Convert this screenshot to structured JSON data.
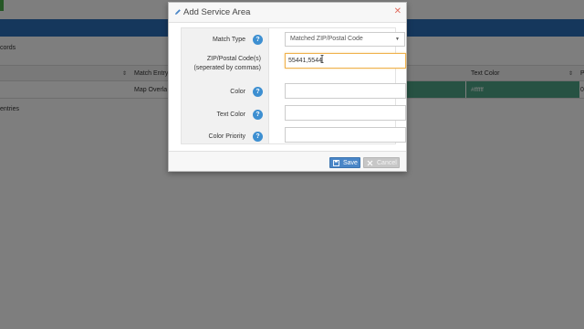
{
  "background": {
    "records_text": "cords",
    "columns": [
      {
        "label": "Match Entry"
      },
      {
        "label": "Text Color"
      },
      {
        "label": "P"
      }
    ],
    "row": {
      "match_entry": "Map Overla",
      "text_color": "#ffffff",
      "trailing": "0"
    },
    "entries_text": "entries",
    "colors": {
      "header_bar": "#2a6fb8",
      "row_color": "#4fa586"
    }
  },
  "modal": {
    "title": "Add Service Area",
    "fields": {
      "match_type": {
        "label": "Match Type",
        "value": "Matched ZIP/Postal Code"
      },
      "zip": {
        "label_line1": "ZIP/Postal Code(s)",
        "label_line2": "(seperated by commas)",
        "value": "55441,5544"
      },
      "color": {
        "label": "Color",
        "value": ""
      },
      "text_color": {
        "label": "Text Color",
        "value": ""
      },
      "color_priority": {
        "label": "Color Priority",
        "value": ""
      }
    },
    "buttons": {
      "save": "Save",
      "cancel": "Cancel"
    },
    "icons": {
      "title": "pencil-icon",
      "close": "close-icon",
      "help": "question-icon",
      "save": "floppy-icon",
      "cancel": "x-icon"
    },
    "accent_colors": {
      "help": "#3d8fd1",
      "focus_border": "#f0b24d",
      "close": "#e06d5f"
    }
  }
}
